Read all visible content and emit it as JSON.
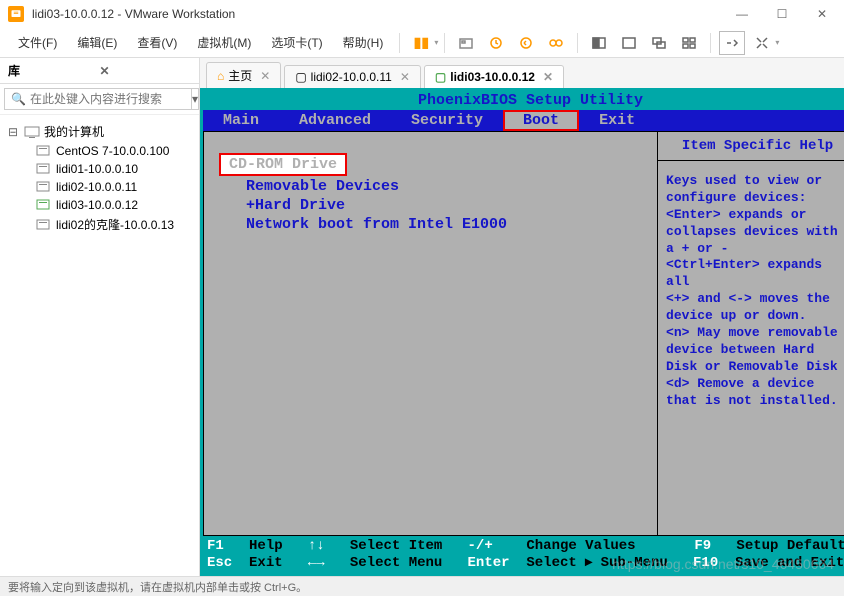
{
  "window": {
    "title": "lidi03-10.0.0.12 - VMware Workstation"
  },
  "menubar": {
    "file": "文件(F)",
    "edit": "编辑(E)",
    "view": "查看(V)",
    "vm": "虚拟机(M)",
    "tabs": "选项卡(T)",
    "help": "帮助(H)"
  },
  "sidebar": {
    "header": "库",
    "searchPlaceholder": "在此处键入内容进行搜索",
    "root": "我的计算机",
    "items": [
      {
        "label": "CentOS 7-10.0.0.100"
      },
      {
        "label": "lidi01-10.0.0.10"
      },
      {
        "label": "lidi02-10.0.0.11"
      },
      {
        "label": "lidi03-10.0.0.12"
      },
      {
        "label": "lidi02的克隆-10.0.0.13"
      }
    ]
  },
  "tabs": {
    "home": "主页",
    "t1": "lidi02-10.0.0.11",
    "t2": "lidi03-10.0.0.12"
  },
  "bios": {
    "title": "PhoenixBIOS Setup Utility",
    "menus": {
      "main": "Main",
      "advanced": "Advanced",
      "security": "Security",
      "boot": "Boot",
      "exit": "Exit"
    },
    "options": {
      "cdrom": "CD-ROM Drive",
      "removable": "Removable Devices",
      "hard": "+Hard Drive",
      "net": "Network boot from Intel E1000"
    },
    "helpHeader": "Item Specific Help",
    "helpText": "Keys used to view or configure devices:\n<Enter> expands or collapses devices with a + or -\n<Ctrl+Enter> expands all\n<+> and <-> moves the device up or down.\n<n> May move removable device between Hard Disk or Removable Disk\n<d> Remove a device that is not installed.",
    "footer": {
      "r1": {
        "k1": "F1",
        "l1": "Help",
        "k2": "↑↓",
        "l2": "Select Item",
        "k3": "-/+",
        "l3": "Change Values",
        "k4": "F9",
        "l4": "Setup Defaults"
      },
      "r2": {
        "k1": "Esc",
        "l1": "Exit",
        "k2": "←→",
        "l2": "Select Menu",
        "k3": "Enter",
        "l3": "Select ▸ Sub-Menu",
        "k4": "F10",
        "l4": "Save and Exit"
      }
    }
  },
  "statusbar": "要将输入定向到该虚拟机，请在虚拟机内部单击或按 Ctrl+G。",
  "watermark": "https://blog.csdn.net/s10_46450664"
}
